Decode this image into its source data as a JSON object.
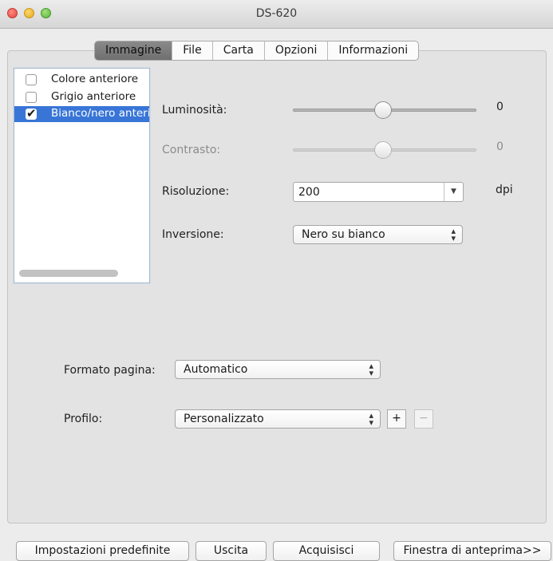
{
  "window": {
    "title": "DS-620"
  },
  "tabs": [
    {
      "label": "Immagine",
      "active": true
    },
    {
      "label": "File",
      "active": false
    },
    {
      "label": "Carta",
      "active": false
    },
    {
      "label": "Opzioni",
      "active": false
    },
    {
      "label": "Informazioni",
      "active": false
    }
  ],
  "image_types": [
    {
      "label": "Colore anteriore",
      "checked": false,
      "selected": false
    },
    {
      "label": "Grigio anteriore",
      "checked": false,
      "selected": false
    },
    {
      "label": "Bianco/nero anteriore",
      "checked": true,
      "selected": true
    }
  ],
  "settings": {
    "brightness": {
      "label": "Luminosità:",
      "value": "0",
      "enabled": true
    },
    "contrast": {
      "label": "Contrasto:",
      "value": "0",
      "enabled": false
    },
    "resolution": {
      "label": "Risoluzione:",
      "value": "200",
      "unit": "dpi"
    },
    "inversion": {
      "label": "Inversione:",
      "value": "Nero su bianco"
    }
  },
  "page_format": {
    "label": "Formato pagina:",
    "value": "Automatico"
  },
  "profile": {
    "label": "Profilo:",
    "value": "Personalizzato",
    "add_label": "+",
    "remove_label": "−"
  },
  "buttons": {
    "defaults": "Impostazioni predefinite",
    "exit": "Uscita",
    "acquire": "Acquisisci",
    "preview": "Finestra di anteprima>>"
  },
  "colors": {
    "selection": "#3875d7",
    "active_tab": "#7a7a7a"
  },
  "icons": {
    "close": "red-traffic-light",
    "minimize": "yellow-traffic-light",
    "maximize": "green-traffic-light",
    "checkmark": "checkmark-icon",
    "popup_arrows": "up-down-chevron-icon"
  }
}
